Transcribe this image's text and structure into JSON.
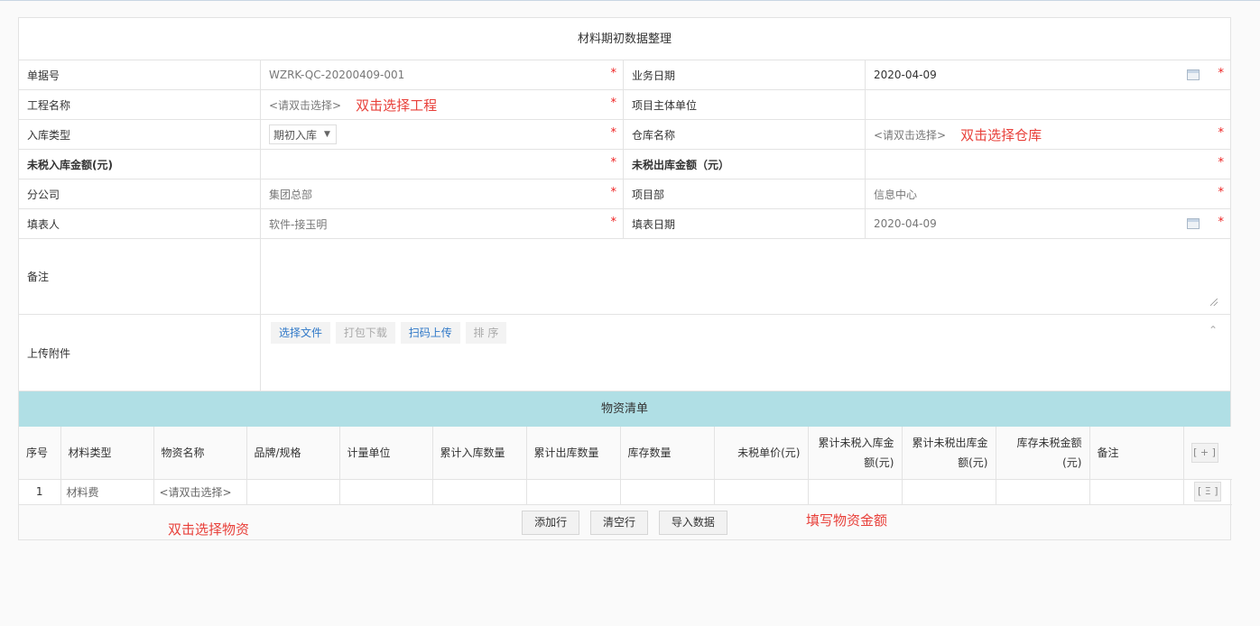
{
  "form": {
    "title": "材料期初数据整理",
    "rows": [
      {
        "label1": "单据号",
        "value1": "WZRK-QC-20200409-001",
        "label2": "业务日期",
        "value2": "2020-04-09"
      },
      {
        "label1": "工程名称",
        "value1": "<请双击选择>",
        "annot1": "双击选择工程",
        "label2": "项目主体单位",
        "value2": ""
      },
      {
        "label1": "入库类型",
        "value1": "期初入库",
        "label2": "仓库名称",
        "value2": "<请双击选择>",
        "annot2": "双击选择仓库"
      },
      {
        "label1": "未税入库金额(元)",
        "value1": "",
        "label2": "未税出库金额（元）",
        "value2": ""
      },
      {
        "label1": "分公司",
        "value1": "集团总部",
        "label2": "项目部",
        "value2": "信息中心"
      },
      {
        "label1": "填表人",
        "value1": "软件-接玉明",
        "label2": "填表日期",
        "value2": "2020-04-09"
      }
    ],
    "memo_label": "备注",
    "upload_label": "上传附件",
    "upload_buttons": [
      "选择文件",
      "打包下载",
      "扫码上传",
      "排 序"
    ],
    "required_mark": "*"
  },
  "materials": {
    "title": "物资清单",
    "headers": [
      "序号",
      "材料类型",
      "物资名称",
      "品牌/规格",
      "计量单位",
      "累计入库数量",
      "累计出库数量",
      "库存数量",
      "未税单价(元)",
      "累计未税入库金额(元)",
      "累计未税出库金额(元)",
      "库存未税金额(元)",
      "备注"
    ],
    "add_col_icon": "[ + ]",
    "rows": [
      {
        "index": "1",
        "type": "材料费",
        "name": "<请双击选择>",
        "menu_icon": "[ Ξ ]"
      }
    ],
    "buttons": {
      "add_row": "添加行",
      "clear_empty": "清空行",
      "import": "导入数据"
    },
    "annot_select": "双击选择物资",
    "annot_amount": "填写物资金额"
  },
  "colors": {
    "section_bg": "#b0dfe5",
    "annotation": "#e8403a",
    "required": "#e22222",
    "link": "#2f78c8"
  }
}
